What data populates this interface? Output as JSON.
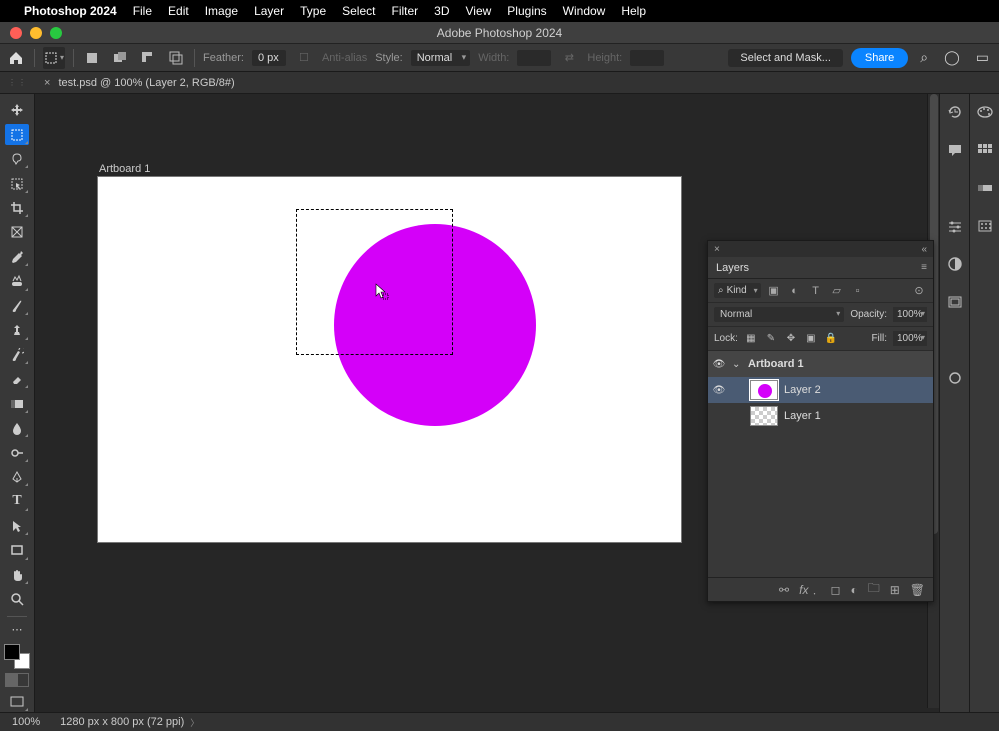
{
  "menubar": {
    "app": "Photoshop 2024",
    "items": [
      "File",
      "Edit",
      "Image",
      "Layer",
      "Type",
      "Select",
      "Filter",
      "3D",
      "View",
      "Plugins",
      "Window",
      "Help"
    ]
  },
  "window_title": "Adobe Photoshop 2024",
  "optbar": {
    "feather_label": "Feather:",
    "feather_value": "0 px",
    "antialias": "Anti-alias",
    "style_label": "Style:",
    "style_value": "Normal",
    "width_label": "Width:",
    "height_label": "Height:",
    "select_mask": "Select and Mask...",
    "share": "Share"
  },
  "doctab": {
    "close": "×",
    "label": "test.psd @ 100% (Layer 2, RGB/8#)"
  },
  "artboard_label": "Artboard 1",
  "layers_panel": {
    "title": "Layers",
    "filter_label": "Kind",
    "blend_mode": "Normal",
    "opacity_label": "Opacity:",
    "opacity_value": "100%",
    "lock_label": "Lock:",
    "fill_label": "Fill:",
    "fill_value": "100%",
    "artboard": "Artboard 1",
    "layer2": "Layer 2",
    "layer1": "Layer 1"
  },
  "status": {
    "zoom": "100%",
    "info": "1280 px x 800 px (72 ppi)"
  },
  "colors": {
    "circle": "#d400f9",
    "share": "#0a84ff"
  }
}
